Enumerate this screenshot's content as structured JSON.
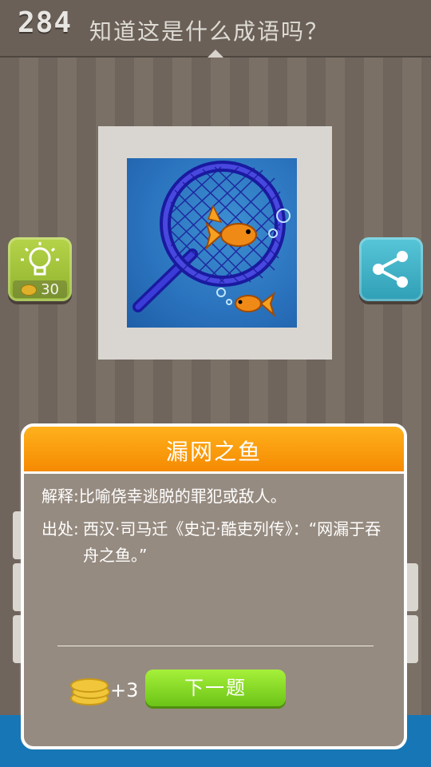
{
  "header": {
    "level": "284",
    "question": "知道这是什么成语吗？"
  },
  "hint": {
    "cost": "30",
    "icon": "lightbulb-icon"
  },
  "share": {
    "icon": "share-icon"
  },
  "dialog": {
    "title": "漏网之鱼",
    "explain_label": "解释:",
    "explain_text": "比喻侥幸逃脱的罪犯或敌人。",
    "source_label": "出处:",
    "source_text": "西汉·司马迁《史记·酷吏列传》：“网漏于吞舟之鱼。”",
    "reward": "+3",
    "next_label": "下一题"
  },
  "colors": {
    "header_orange": "#f58a02",
    "next_green": "#7fd21e",
    "hint_green": "#9bbd33",
    "share_teal": "#3aadc2",
    "bottom_blue": "#1777b6"
  }
}
